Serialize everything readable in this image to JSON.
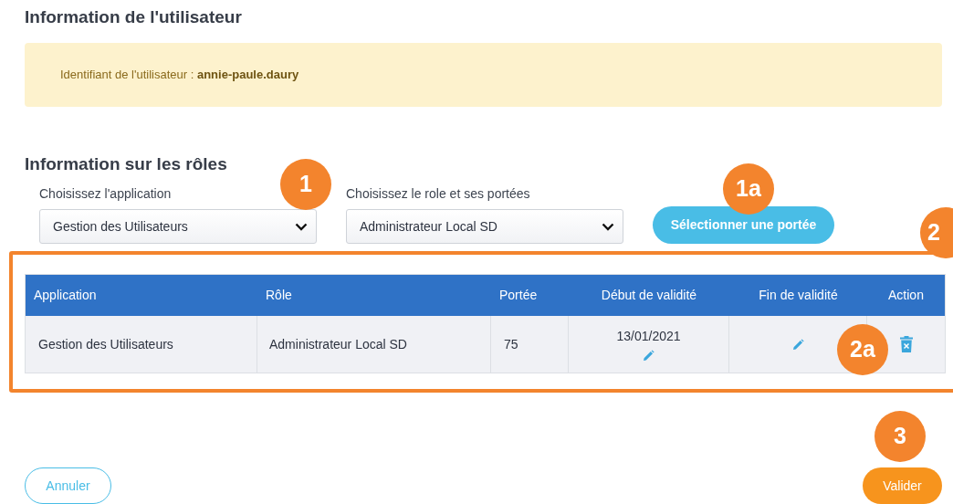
{
  "user_section": {
    "title": "Information de l'utilisateur",
    "identifier_label": "Identifiant de l'utilisateur :",
    "identifier_value": "annie-paule.daury"
  },
  "roles_section": {
    "title": "Information sur les rôles",
    "application_select": {
      "label": "Choisissez l'application",
      "value": "Gestion des Utilisateurs"
    },
    "role_select": {
      "label": "Choisissez le role et ses portées",
      "value": "Administrateur Local SD"
    },
    "scope_button": "Sélectionner une portée"
  },
  "table": {
    "columns": [
      "Application",
      "Rôle",
      "Portée",
      "Début de validité",
      "Fin de validité",
      "Action"
    ],
    "rows": [
      {
        "application": "Gestion des Utilisateurs",
        "role": "Administrateur Local SD",
        "scope": "75",
        "start": "13/01/2021"
      }
    ]
  },
  "buttons": {
    "cancel": "Annuler",
    "submit": "Valider"
  },
  "annotations": [
    "1",
    "1a",
    "2",
    "2a",
    "3"
  ]
}
